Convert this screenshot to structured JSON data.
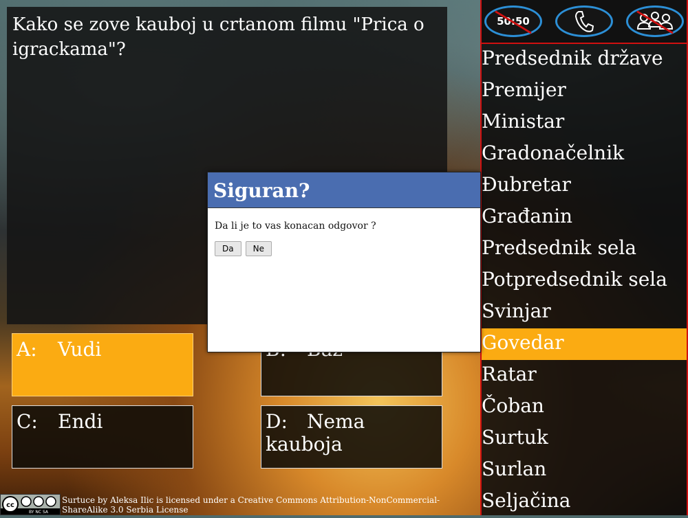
{
  "question": "Kako se zove kauboj u crtanom filmu \"Prica o igrackama\"?",
  "answers": [
    {
      "letter": "A:",
      "text": "Vudi",
      "selected": true
    },
    {
      "letter": "B:",
      "text": "Baz",
      "selected": false
    },
    {
      "letter": "C:",
      "text": "Endi",
      "selected": false
    },
    {
      "letter": "D:",
      "text": "Nema kauboja",
      "selected": false
    }
  ],
  "lifelines": {
    "fifty_fifty": {
      "label": "50:50",
      "icon": "fifty-fifty-icon",
      "used": true
    },
    "phone": {
      "icon": "phone-icon",
      "used": false
    },
    "audience": {
      "icon": "audience-icon",
      "used": true
    }
  },
  "ladder": [
    "Predsednik države",
    "Premijer",
    "Ministar",
    "Gradonačelnik",
    "Đubretar",
    "Građanin",
    "Predsednik sela",
    "Potpredsednik sela",
    "Svinjar",
    "Govedar",
    "Ratar",
    "Čoban",
    "Surtuk",
    "Surlan",
    "Seljačina"
  ],
  "ladder_current_index": 9,
  "modal": {
    "title": "Siguran?",
    "message": "Da li je to vas konacan odgovor ?",
    "yes_label": "Da",
    "no_label": "Ne"
  },
  "footer": {
    "cc_badge_text": "BY NC SA",
    "license_text": "Surtuce by Aleksa Ilic is licensed under a Creative Commons Attribution-NonCommercial-ShareAlike 3.0 Serbia License"
  },
  "colors": {
    "highlight": "#fbab12",
    "modal_header": "#4a6db0",
    "panel_border": "#d01010",
    "lifeline_ring": "#2c8fd6"
  }
}
